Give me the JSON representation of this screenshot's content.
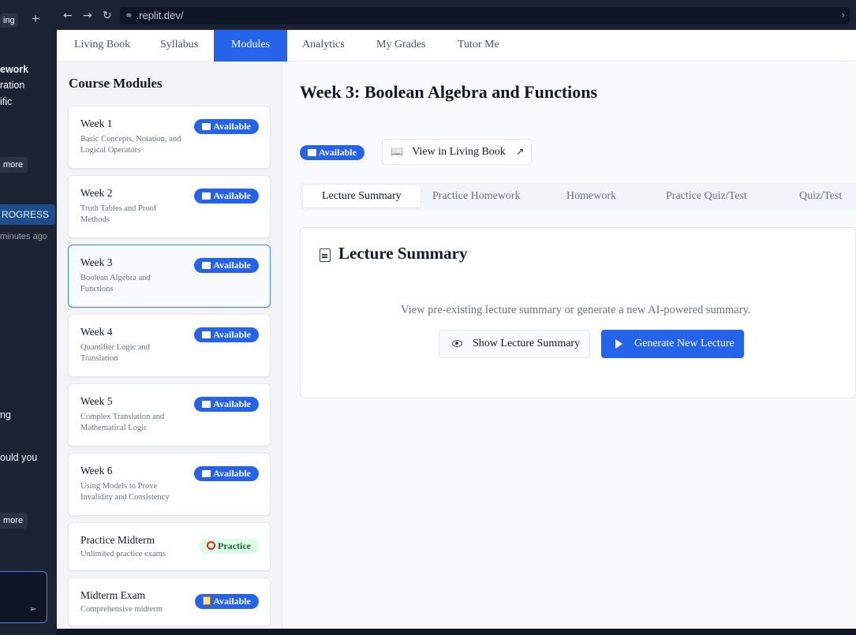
{
  "left_panel": {
    "texts": [
      "ing",
      "ework",
      "ration",
      "ific",
      "ng",
      "ould you"
    ],
    "buttons": [
      "more",
      "more"
    ],
    "progress_label": "ROGRESS",
    "progress_time": "minutes ago"
  },
  "browser": {
    "url": ".replit.dev/"
  },
  "top_tabs": [
    {
      "label": "Living Book"
    },
    {
      "label": "Syllabus"
    },
    {
      "label": "Modules"
    },
    {
      "label": "Analytics"
    },
    {
      "label": "My Grades"
    },
    {
      "label": "Tutor Me"
    }
  ],
  "active_top_tab": "Modules",
  "sidebar": {
    "heading": "Course Modules",
    "modules": [
      {
        "title": "Week 1",
        "desc": "Basic Concepts, Notation, and Logical Operators",
        "badge": "Available"
      },
      {
        "title": "Week 2",
        "desc": "Truth Tables and Proof Methods",
        "badge": "Available"
      },
      {
        "title": "Week 3",
        "desc": "Boolean Algebra and Functions",
        "badge": "Available"
      },
      {
        "title": "Week 4",
        "desc": "Quantifier Logic and Translation",
        "badge": "Available"
      },
      {
        "title": "Week 5",
        "desc": "Complex Translation and Mathematical Logic",
        "badge": "Available"
      },
      {
        "title": "Week 6",
        "desc": "Using Models to Prove Invalidity and Consistency",
        "badge": "Available"
      },
      {
        "title": "Practice Midterm",
        "desc": "Unlimited practice exams",
        "badge": "Practice"
      },
      {
        "title": "Midterm Exam",
        "desc": "Comprehensive midterm",
        "badge": "Available"
      }
    ]
  },
  "main": {
    "title": "Week 3: Boolean Algebra and Functions",
    "status_badge": "Available",
    "view_book_label": "View in Living Book",
    "sub_tabs": [
      "Lecture Summary",
      "Practice Homework",
      "Homework",
      "Practice Quiz/Test",
      "Quiz/Test"
    ],
    "active_sub_tab": "Lecture Summary",
    "panel": {
      "heading": "Lecture Summary",
      "hint": "View pre-existing lecture summary or generate a new AI-powered summary.",
      "show_button": "Show Lecture Summary",
      "generate_button": "Generate New Lecture"
    }
  },
  "colors": {
    "accent": "#2563eb",
    "practice_bg": "#dcfce7",
    "practice_text": "#166534"
  },
  "icons": [
    "arrow-left-icon",
    "arrow-right-icon",
    "reload-icon",
    "link-icon",
    "book-icon",
    "external-link-icon",
    "document-icon",
    "eye-icon",
    "play-icon",
    "target-icon",
    "memo-icon",
    "send-icon",
    "plus-icon"
  ]
}
